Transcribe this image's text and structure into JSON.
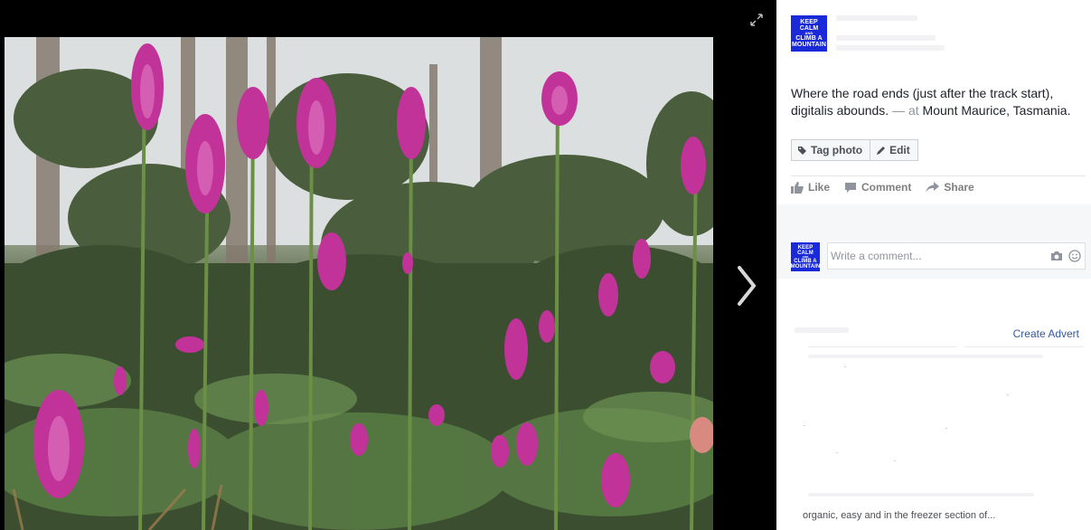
{
  "viewer": {
    "expand_icon": "expand-icon",
    "next_icon": "chevron-right-icon",
    "photo_subject": "foxgloves"
  },
  "post": {
    "avatar_lines": [
      "KEEP",
      "CALM",
      "AND",
      "CLIMB A",
      "MOUNTAIN"
    ],
    "caption": "Where the road ends (just after the track start), digitalis abounds.",
    "location_separator": " — at ",
    "location": "Mount Maurice, Tasmania",
    "location_end": "."
  },
  "photo_buttons": {
    "tag_label": "Tag photo",
    "tag_icon": "tag-icon",
    "edit_label": "Edit",
    "edit_icon": "pencil-icon"
  },
  "actions": {
    "like": "Like",
    "comment": "Comment",
    "share": "Share"
  },
  "comment_box": {
    "placeholder": "Write a comment...",
    "camera_icon": "camera-icon",
    "emoji_icon": "emoji-icon"
  },
  "sidebar_ads": {
    "create_advert": "Create Advert",
    "ad_text": "organic, easy and in the freezer section of..."
  },
  "colors": {
    "panel_bg": "#ffffff",
    "grey_bg": "#f6f7f9",
    "link": "#365899",
    "avatar_bg": "#1a2ad8",
    "foxglove": "#c2339a"
  }
}
